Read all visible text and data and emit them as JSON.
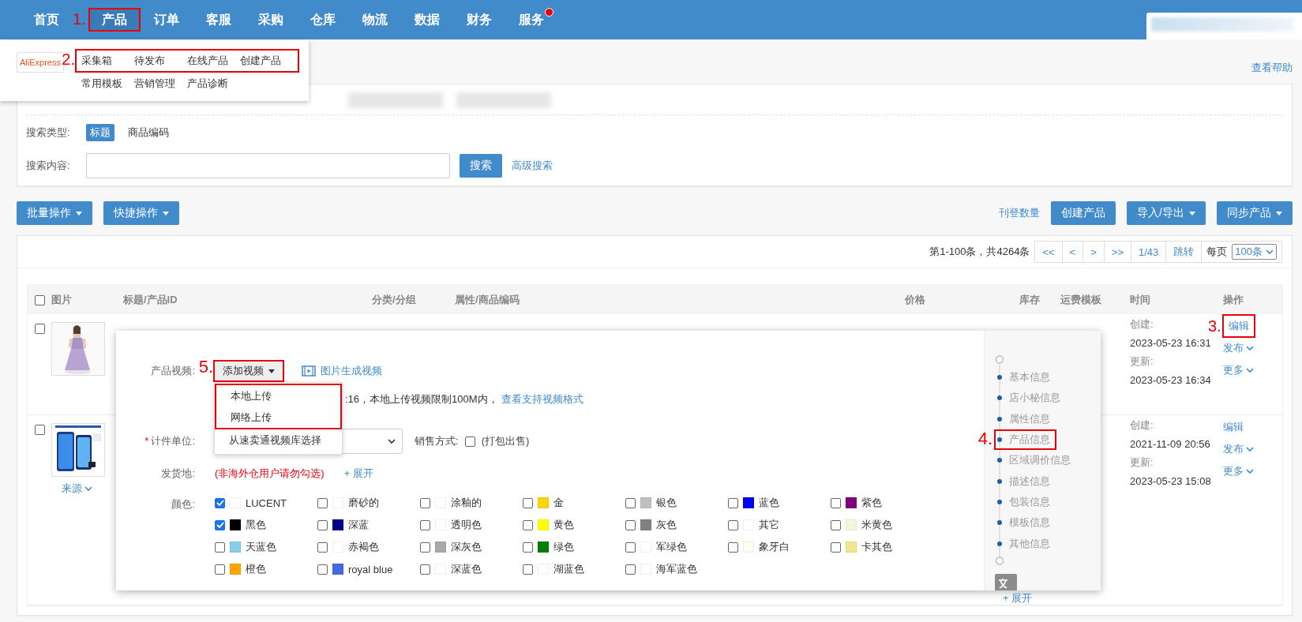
{
  "nav": {
    "items": [
      {
        "label": "首页",
        "selected": false,
        "has_dot": false
      },
      {
        "label": "产品",
        "selected": true,
        "has_dot": false,
        "annotation": "1."
      },
      {
        "label": "订单",
        "selected": false,
        "has_dot": false
      },
      {
        "label": "客服",
        "selected": false,
        "has_dot": false
      },
      {
        "label": "采购",
        "selected": false,
        "has_dot": false
      },
      {
        "label": "仓库",
        "selected": false,
        "has_dot": false
      },
      {
        "label": "物流",
        "selected": false,
        "has_dot": false
      },
      {
        "label": "数据",
        "selected": false,
        "has_dot": false
      },
      {
        "label": "财务",
        "selected": false,
        "has_dot": false
      },
      {
        "label": "服务",
        "selected": false,
        "has_dot": true
      }
    ]
  },
  "menu": {
    "logo": "AliExpress",
    "rows": [
      {
        "annotation": "2.",
        "items": [
          "采集箱",
          "待发布",
          "在线产品",
          "创建产品"
        ]
      },
      {
        "items": [
          "常用模板",
          "营销管理",
          "产品诊断"
        ]
      }
    ]
  },
  "help_link": "查看帮助",
  "filters": {
    "search_type": {
      "label": "搜索类型:",
      "options": [
        {
          "label": "标题",
          "selected": true
        },
        {
          "label": "商品编码",
          "selected": false
        }
      ]
    },
    "search_content": {
      "label": "搜索内容:",
      "button": "搜索",
      "advanced": "高级搜索"
    }
  },
  "toolbar": {
    "left": [
      {
        "label": "批量操作",
        "caret": true
      },
      {
        "label": "快捷操作",
        "caret": true
      }
    ],
    "link": "刊登数量",
    "right": [
      {
        "label": "创建产品",
        "caret": false
      },
      {
        "label": "导入/导出",
        "caret": true
      },
      {
        "label": "同步产品",
        "caret": true
      }
    ]
  },
  "pagination": {
    "summary": "第1-100条，共4264条",
    "buttons": [
      "<<",
      "<",
      ">",
      ">>",
      "1/43",
      "跳转"
    ],
    "per_page_label": "每页",
    "per_page": "100条"
  },
  "table": {
    "select_all": false,
    "columns": [
      "图片",
      "标题/产品ID",
      "分类/分组",
      "属性/商品编码",
      "价格",
      "库存",
      "运费模板",
      "时间",
      "操作"
    ],
    "rows": [
      {
        "checked": false,
        "created_label": "创建:",
        "created": "2023-05-23 16:31",
        "updated_label": "更新:",
        "updated": "2023-05-23 16:34",
        "actions": [
          {
            "label": "编辑",
            "caret": false,
            "annotation": "3."
          },
          {
            "label": "发布",
            "caret": true
          },
          {
            "label": "更多",
            "caret": true
          }
        ]
      },
      {
        "checked": false,
        "source": "来源",
        "created_label": "创建:",
        "created": "2021-11-09 20:56",
        "updated_label": "更新:",
        "updated": "2023-05-23 15:08",
        "actions": [
          {
            "label": "编辑",
            "caret": false
          },
          {
            "label": "发布",
            "caret": true
          },
          {
            "label": "更多",
            "caret": true
          }
        ]
      }
    ]
  },
  "editor": {
    "video": {
      "label": "产品视频:",
      "annotation": "5.",
      "button": "添加视频",
      "generate": "图片生成视频",
      "options": [
        {
          "label": "本地上传",
          "highlighted": true
        },
        {
          "label": "网络上传",
          "highlighted": true
        },
        {
          "label": "从速卖通视频库选择",
          "highlighted": false
        }
      ],
      "hint": ":16，本地上传视频限制100M内，",
      "hint_link": "查看支持视频格式"
    },
    "unit": {
      "label": "计件单位:",
      "required_mark": "*"
    },
    "sale": {
      "label": "销售方式:",
      "checked": false,
      "option": "(打包出售)"
    },
    "ship": {
      "label": "发货地:",
      "note": "(非海外仓用户请勿勾选)",
      "expand": "+ 展开"
    },
    "colors": {
      "label": "颜色:",
      "items": [
        {
          "name": "LUCENT",
          "color": "#ffffff",
          "checked": true
        },
        {
          "name": "磨砂的",
          "color": "#ffffff",
          "checked": false
        },
        {
          "name": "涂釉的",
          "color": "#ffffff",
          "checked": false
        },
        {
          "name": "金",
          "color": "#ffd700",
          "checked": false
        },
        {
          "name": "银色",
          "color": "#c0c0c0",
          "checked": false
        },
        {
          "name": "蓝色",
          "color": "#0000ff",
          "checked": false
        },
        {
          "name": "紫色",
          "color": "#800080",
          "checked": false
        },
        {
          "name": "黑色",
          "color": "#000000",
          "checked": true
        },
        {
          "name": "深蓝",
          "color": "#00008b",
          "checked": false
        },
        {
          "name": "透明色",
          "color": "#ffffff",
          "checked": false
        },
        {
          "name": "黄色",
          "color": "#ffff00",
          "checked": false
        },
        {
          "name": "灰色",
          "color": "#808080",
          "checked": false
        },
        {
          "name": "其它",
          "color": "#ffffff",
          "checked": false
        },
        {
          "name": "米黄色",
          "color": "#f5f5dc",
          "checked": false
        },
        {
          "name": "天蓝色",
          "color": "#87ceeb",
          "checked": false
        },
        {
          "name": "赤褐色",
          "color": "#ffffff",
          "checked": false
        },
        {
          "name": "深灰色",
          "color": "#a9a9a9",
          "checked": false
        },
        {
          "name": "绿色",
          "color": "#008000",
          "checked": false
        },
        {
          "name": "军绿色",
          "color": "#ffffff",
          "checked": false
        },
        {
          "name": "象牙白",
          "color": "#fffff0",
          "checked": false
        },
        {
          "name": "卡其色",
          "color": "#f0e68c",
          "checked": false
        },
        {
          "name": "橙色",
          "color": "#ffa500",
          "checked": false
        },
        {
          "name": "royal blue",
          "color": "#4169e1",
          "checked": false
        },
        {
          "name": "深蓝色",
          "color": "#ffffff",
          "checked": false
        },
        {
          "name": "湖蓝色",
          "color": "#ffffff",
          "checked": false
        },
        {
          "name": "海军蓝色",
          "color": "#ffffff",
          "checked": false
        }
      ]
    },
    "sections": [
      {
        "label": "基本信息",
        "selected": false
      },
      {
        "label": "店小秘信息",
        "selected": false
      },
      {
        "label": "属性信息",
        "selected": false
      },
      {
        "label": "产品信息",
        "selected": false,
        "annotation": "4."
      },
      {
        "label": "区域调价信息",
        "selected": false
      },
      {
        "label": "描述信息",
        "selected": false
      },
      {
        "label": "包装信息",
        "selected": false
      },
      {
        "label": "模板信息",
        "selected": false
      },
      {
        "label": "其他信息",
        "selected": false
      }
    ],
    "expand": "+ 展开"
  }
}
